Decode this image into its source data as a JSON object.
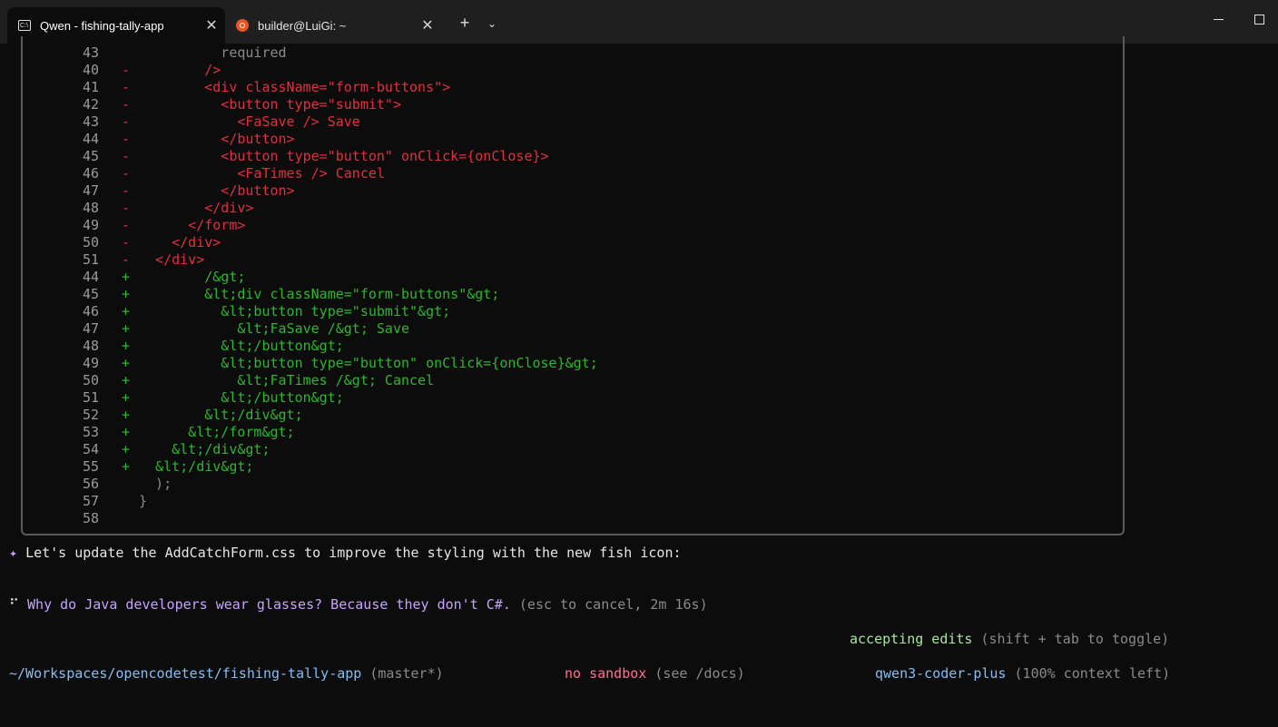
{
  "titlebar": {
    "tabs": [
      {
        "label": "Qwen - fishing-tally-app",
        "icon": "terminal-icon",
        "active": true
      },
      {
        "label": "builder@LuiGi: ~",
        "icon": "ubuntu-icon",
        "active": false
      }
    ],
    "new_tab": "+",
    "dropdown": "⌄",
    "close": "✕"
  },
  "diff": {
    "lines": [
      {
        "n": "43",
        "s": "",
        "t": "          required",
        "k": "ctx"
      },
      {
        "n": "40",
        "s": "-",
        "t": "        />",
        "k": "del"
      },
      {
        "n": "41",
        "s": "-",
        "t": "        <div className=\"form-buttons\">",
        "k": "del"
      },
      {
        "n": "42",
        "s": "-",
        "t": "          <button type=\"submit\">",
        "k": "del"
      },
      {
        "n": "43",
        "s": "-",
        "t": "            <FaSave /> Save",
        "k": "del"
      },
      {
        "n": "44",
        "s": "-",
        "t": "          </button>",
        "k": "del"
      },
      {
        "n": "45",
        "s": "-",
        "t": "          <button type=\"button\" onClick={onClose}>",
        "k": "del"
      },
      {
        "n": "46",
        "s": "-",
        "t": "            <FaTimes /> Cancel",
        "k": "del"
      },
      {
        "n": "47",
        "s": "-",
        "t": "          </button>",
        "k": "del"
      },
      {
        "n": "48",
        "s": "-",
        "t": "        </div>",
        "k": "del"
      },
      {
        "n": "49",
        "s": "-",
        "t": "      </form>",
        "k": "del"
      },
      {
        "n": "50",
        "s": "-",
        "t": "    </div>",
        "k": "del"
      },
      {
        "n": "51",
        "s": "-",
        "t": "  </div>",
        "k": "del"
      },
      {
        "n": "44",
        "s": "+",
        "t": "        /&gt;",
        "k": "add"
      },
      {
        "n": "45",
        "s": "+",
        "t": "        &lt;div className=\"form-buttons\"&gt;",
        "k": "add"
      },
      {
        "n": "46",
        "s": "+",
        "t": "          &lt;button type=\"submit\"&gt;",
        "k": "add"
      },
      {
        "n": "47",
        "s": "+",
        "t": "            &lt;FaSave /&gt; Save",
        "k": "add"
      },
      {
        "n": "48",
        "s": "+",
        "t": "          &lt;/button&gt;",
        "k": "add"
      },
      {
        "n": "49",
        "s": "+",
        "t": "          &lt;button type=\"button\" onClick={onClose}&gt;",
        "k": "add"
      },
      {
        "n": "50",
        "s": "+",
        "t": "            &lt;FaTimes /&gt; Cancel",
        "k": "add"
      },
      {
        "n": "51",
        "s": "+",
        "t": "          &lt;/button&gt;",
        "k": "add"
      },
      {
        "n": "52",
        "s": "+",
        "t": "        &lt;/div&gt;",
        "k": "add"
      },
      {
        "n": "53",
        "s": "+",
        "t": "      &lt;/form&gt;",
        "k": "add"
      },
      {
        "n": "54",
        "s": "+",
        "t": "    &lt;/div&gt;",
        "k": "add"
      },
      {
        "n": "55",
        "s": "+",
        "t": "  &lt;/div&gt;",
        "k": "add"
      },
      {
        "n": "56",
        "s": "",
        "t": "  );",
        "k": "ctx"
      },
      {
        "n": "57",
        "s": "",
        "t": "}",
        "k": "ctx"
      },
      {
        "n": "58",
        "s": "",
        "t": "",
        "k": "ctx"
      }
    ]
  },
  "message": {
    "icon": "✦",
    "text": "Let's update the AddCatchForm.css to improve the styling with the new fish icon:"
  },
  "joke": {
    "spinner": "⠋",
    "text": "Why do Java developers wear glasses? Because they don't C#.",
    "meta": " (esc to cancel, 2m 16s)"
  },
  "status": {
    "accepting": "accepting edits",
    "accepting_hint": " (shift + tab to toggle)"
  },
  "footer": {
    "path": "~/Workspaces/opencodetest/fishing-tally-app",
    "branch": " (master*)",
    "sandbox": "no sandbox",
    "sandbox_hint": " (see /docs)",
    "model": "qwen3-coder-plus",
    "context": " (100% context left)"
  }
}
